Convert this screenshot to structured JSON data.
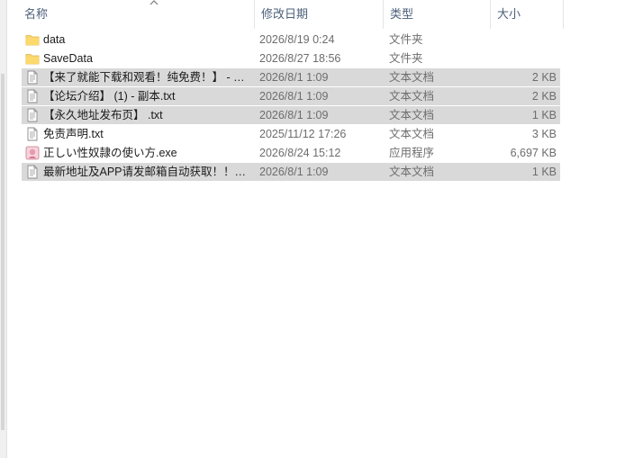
{
  "columns": {
    "name": "名称",
    "date": "修改日期",
    "type": "类型",
    "size": "大小"
  },
  "files": [
    {
      "name": "data",
      "date": "2026/8/19 0:24",
      "type": "文件夹",
      "size": "",
      "icon": "folder-icon",
      "selected": false
    },
    {
      "name": "SaveData",
      "date": "2026/8/27 18:56",
      "type": "文件夹",
      "size": "",
      "icon": "folder-icon",
      "selected": false
    },
    {
      "name": "【来了就能下载和观看！纯免费！】 - 副...",
      "date": "2026/8/1 1:09",
      "type": "文本文档",
      "size": "2 KB",
      "icon": "text-file-icon",
      "selected": true
    },
    {
      "name": "【论坛介绍】 (1) - 副本.txt",
      "date": "2026/8/1 1:09",
      "type": "文本文档",
      "size": "2 KB",
      "icon": "text-file-icon",
      "selected": true
    },
    {
      "name": "【永久地址发布页】 .txt",
      "date": "2026/8/1 1:09",
      "type": "文本文档",
      "size": "1 KB",
      "icon": "text-file-icon",
      "selected": true
    },
    {
      "name": "免责声明.txt",
      "date": "2025/11/12 17:26",
      "type": "文本文档",
      "size": "3 KB",
      "icon": "text-file-icon",
      "selected": false
    },
    {
      "name": "正しい性奴隷の使い方.exe",
      "date": "2026/8/24 15:12",
      "type": "应用程序",
      "size": "6,697 KB",
      "icon": "app-icon",
      "selected": false
    },
    {
      "name": "最新地址及APP请发邮箱自动获取！！！...",
      "date": "2026/8/1 1:09",
      "type": "文本文档",
      "size": "1 KB",
      "icon": "text-file-icon",
      "selected": true
    }
  ]
}
